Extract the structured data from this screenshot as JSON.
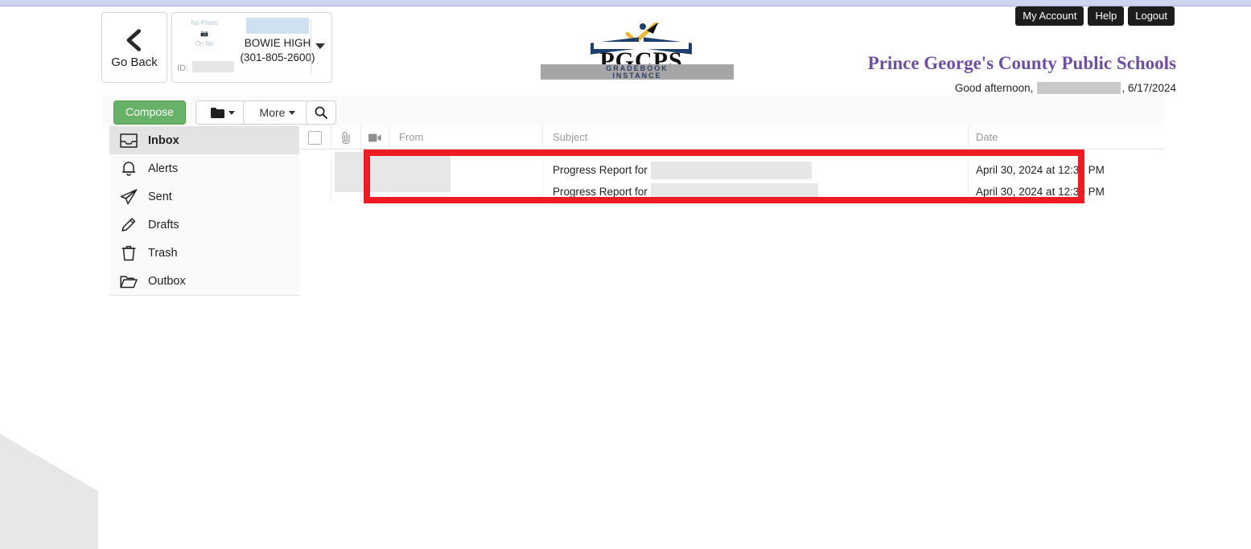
{
  "header": {
    "go_back_label": "Go Back",
    "student_card": {
      "photo_placeholder_line1": "No Photo",
      "photo_placeholder_line2": "On file",
      "id_label": "ID:",
      "id_value": "",
      "student_name": "",
      "school_name": "BOWIE HIGH",
      "school_phone": "(301-805-2600)"
    },
    "logo": {
      "wordmark": "PGCPS",
      "band_line1": "GRADEBOOK",
      "band_line2": "INSTANCE"
    },
    "top_buttons": [
      {
        "label": "My Account"
      },
      {
        "label": "Help"
      },
      {
        "label": "Logout"
      }
    ],
    "district_title": "Prince George's County Public Schools",
    "greeting_prefix": "Good afternoon,",
    "greeting_name": "",
    "greeting_date": ", 6/17/2024"
  },
  "toolbar": {
    "compose_label": "Compose",
    "folder_label": "",
    "more_label": "More",
    "search_label": ""
  },
  "sidebar": {
    "items": [
      {
        "label": "Inbox",
        "icon": "inbox-icon",
        "active": true
      },
      {
        "label": "Alerts",
        "icon": "bell-icon",
        "active": false
      },
      {
        "label": "Sent",
        "icon": "paper-plane-icon",
        "active": false
      },
      {
        "label": "Drafts",
        "icon": "pencil-icon",
        "active": false
      },
      {
        "label": "Trash",
        "icon": "trash-icon",
        "active": false
      },
      {
        "label": "Outbox",
        "icon": "folder-icon",
        "active": false
      }
    ]
  },
  "message_list": {
    "columns": {
      "select_all": "",
      "attachment": "paperclip-icon",
      "video": "video-camera-icon",
      "from": "From",
      "subject": "Subject",
      "date": "Date"
    },
    "rows": [
      {
        "from": "",
        "subject_prefix": "Progress Report for",
        "subject_redacted": true,
        "date": "April 30, 2024 at 12:31 PM"
      },
      {
        "from": "",
        "subject_prefix": "Progress Report for",
        "subject_redacted": true,
        "date": "April 30, 2024 at 12:30 PM"
      }
    ]
  },
  "annotation": {
    "highlight_color": "#ee1c22",
    "shape": "rectangle"
  },
  "colors": {
    "compose_green": "#67b168",
    "district_purple": "#6f4fa3",
    "top_strip": "#ced4ee",
    "highlight_red": "#ee1c22"
  }
}
